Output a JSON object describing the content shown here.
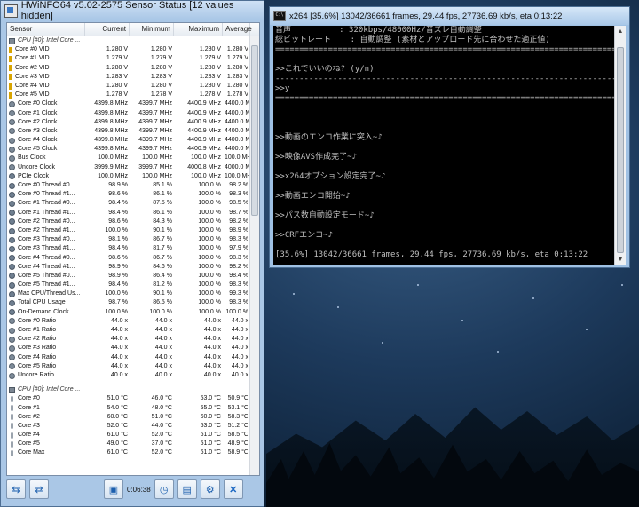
{
  "hwinfo": {
    "title": "HWiNFO64 v5.02-2575 Sensor Status [12 values hidden]",
    "columns": [
      "Sensor",
      "Current",
      "Minimum",
      "Maximum",
      "Average"
    ],
    "rows": [
      {
        "type": "group",
        "icon": "chip",
        "cells": [
          "CPU [#0]: Intel Core ...",
          "",
          "",
          "",
          ""
        ]
      },
      {
        "type": "volt",
        "cells": [
          "Core #0 VID",
          "1.280 V",
          "1.280 V",
          "1.280 V",
          "1.280 V"
        ]
      },
      {
        "type": "volt",
        "cells": [
          "Core #1 VID",
          "1.279 V",
          "1.279 V",
          "1.279 V",
          "1.279 V"
        ]
      },
      {
        "type": "volt",
        "cells": [
          "Core #2 VID",
          "1.280 V",
          "1.280 V",
          "1.280 V",
          "1.280 V"
        ]
      },
      {
        "type": "volt",
        "cells": [
          "Core #3 VID",
          "1.283 V",
          "1.283 V",
          "1.283 V",
          "1.283 V"
        ]
      },
      {
        "type": "volt",
        "cells": [
          "Core #4 VID",
          "1.280 V",
          "1.280 V",
          "1.280 V",
          "1.280 V"
        ]
      },
      {
        "type": "volt",
        "cells": [
          "Core #5 VID",
          "1.278 V",
          "1.278 V",
          "1.278 V",
          "1.278 V"
        ]
      },
      {
        "type": "clock",
        "cells": [
          "Core #0 Clock",
          "4399.8 MHz",
          "4399.7 MHz",
          "4400.9 MHz",
          "4400.0 MHz"
        ]
      },
      {
        "type": "clock",
        "cells": [
          "Core #1 Clock",
          "4399.8 MHz",
          "4399.7 MHz",
          "4400.9 MHz",
          "4400.0 MHz"
        ]
      },
      {
        "type": "clock",
        "cells": [
          "Core #2 Clock",
          "4399.8 MHz",
          "4399.7 MHz",
          "4400.9 MHz",
          "4400.0 MHz"
        ]
      },
      {
        "type": "clock",
        "cells": [
          "Core #3 Clock",
          "4399.8 MHz",
          "4399.7 MHz",
          "4400.9 MHz",
          "4400.0 MHz"
        ]
      },
      {
        "type": "clock",
        "cells": [
          "Core #4 Clock",
          "4399.8 MHz",
          "4399.7 MHz",
          "4400.9 MHz",
          "4400.0 MHz"
        ]
      },
      {
        "type": "clock",
        "cells": [
          "Core #5 Clock",
          "4399.8 MHz",
          "4399.7 MHz",
          "4400.9 MHz",
          "4400.0 MHz"
        ]
      },
      {
        "type": "clock",
        "cells": [
          "Bus Clock",
          "100.0 MHz",
          "100.0 MHz",
          "100.0 MHz",
          "100.0 MHz"
        ]
      },
      {
        "type": "clock",
        "cells": [
          "Uncore Clock",
          "3999.9 MHz",
          "3999.7 MHz",
          "4000.8 MHz",
          "4000.0 MHz"
        ]
      },
      {
        "type": "usage",
        "cells": [
          "PCIe Clock",
          "100.0 MHz",
          "100.0 MHz",
          "100.0 MHz",
          "100.0 MHz"
        ]
      },
      {
        "type": "usage",
        "cells": [
          "Core #0 Thread #0...",
          "98.9 %",
          "85.1 %",
          "100.0 %",
          "98.2 %"
        ]
      },
      {
        "type": "usage",
        "cells": [
          "Core #0 Thread #1...",
          "98.6 %",
          "86.1 %",
          "100.0 %",
          "98.3 %"
        ]
      },
      {
        "type": "usage",
        "cells": [
          "Core #1 Thread #0...",
          "98.4 %",
          "87.5 %",
          "100.0 %",
          "98.5 %"
        ]
      },
      {
        "type": "usage",
        "cells": [
          "Core #1 Thread #1...",
          "98.4 %",
          "86.1 %",
          "100.0 %",
          "98.7 %"
        ]
      },
      {
        "type": "usage",
        "cells": [
          "Core #2 Thread #0...",
          "98.6 %",
          "84.3 %",
          "100.0 %",
          "98.2 %"
        ]
      },
      {
        "type": "usage",
        "cells": [
          "Core #2 Thread #1...",
          "100.0 %",
          "90.1 %",
          "100.0 %",
          "98.9 %"
        ]
      },
      {
        "type": "usage",
        "cells": [
          "Core #3 Thread #0...",
          "98.1 %",
          "86.7 %",
          "100.0 %",
          "98.3 %"
        ]
      },
      {
        "type": "usage",
        "cells": [
          "Core #3 Thread #1...",
          "98.4 %",
          "81.7 %",
          "100.0 %",
          "97.9 %"
        ]
      },
      {
        "type": "usage",
        "cells": [
          "Core #4 Thread #0...",
          "98.6 %",
          "86.7 %",
          "100.0 %",
          "98.3 %"
        ]
      },
      {
        "type": "usage",
        "cells": [
          "Core #4 Thread #1...",
          "98.9 %",
          "84.6 %",
          "100.0 %",
          "98.2 %"
        ]
      },
      {
        "type": "usage",
        "cells": [
          "Core #5 Thread #0...",
          "98.9 %",
          "86.4 %",
          "100.0 %",
          "98.4 %"
        ]
      },
      {
        "type": "usage",
        "cells": [
          "Core #5 Thread #1...",
          "98.4 %",
          "81.2 %",
          "100.0 %",
          "98.3 %"
        ]
      },
      {
        "type": "usage",
        "cells": [
          "Max CPU/Thread Us...",
          "100.0 %",
          "90.1 %",
          "100.0 %",
          "99.3 %"
        ]
      },
      {
        "type": "usage",
        "cells": [
          "Total CPU Usage",
          "98.7 %",
          "86.5 %",
          "100.0 %",
          "98.3 %"
        ]
      },
      {
        "type": "usage",
        "cells": [
          "On-Demand Clock ...",
          "100.0 %",
          "100.0 %",
          "100.0 %",
          "100.0 %"
        ]
      },
      {
        "type": "clock",
        "cells": [
          "Core #0 Ratio",
          "44.0 x",
          "44.0 x",
          "44.0 x",
          "44.0 x"
        ]
      },
      {
        "type": "clock",
        "cells": [
          "Core #1 Ratio",
          "44.0 x",
          "44.0 x",
          "44.0 x",
          "44.0 x"
        ]
      },
      {
        "type": "clock",
        "cells": [
          "Core #2 Ratio",
          "44.0 x",
          "44.0 x",
          "44.0 x",
          "44.0 x"
        ]
      },
      {
        "type": "clock",
        "cells": [
          "Core #3 Ratio",
          "44.0 x",
          "44.0 x",
          "44.0 x",
          "44.0 x"
        ]
      },
      {
        "type": "clock",
        "cells": [
          "Core #4 Ratio",
          "44.0 x",
          "44.0 x",
          "44.0 x",
          "44.0 x"
        ]
      },
      {
        "type": "clock",
        "cells": [
          "Core #5 Ratio",
          "44.0 x",
          "44.0 x",
          "44.0 x",
          "44.0 x"
        ]
      },
      {
        "type": "clock",
        "cells": [
          "Uncore Ratio",
          "40.0 x",
          "40.0 x",
          "40.0 x",
          "40.0 x"
        ]
      },
      {
        "type": "blank",
        "cells": [
          "",
          "",
          "",
          "",
          ""
        ]
      },
      {
        "type": "group",
        "icon": "chip",
        "cells": [
          "CPU [#0]: Intel Core ...",
          "",
          "",
          "",
          ""
        ]
      },
      {
        "type": "temp",
        "cells": [
          "Core #0",
          "51.0 °C",
          "46.0 °C",
          "53.0 °C",
          "50.9 °C"
        ]
      },
      {
        "type": "temp",
        "cells": [
          "Core #1",
          "54.0 °C",
          "48.0 °C",
          "55.0 °C",
          "53.1 °C"
        ]
      },
      {
        "type": "temp",
        "cells": [
          "Core #2",
          "60.0 °C",
          "51.0 °C",
          "60.0 °C",
          "58.3 °C"
        ]
      },
      {
        "type": "temp",
        "cells": [
          "Core #3",
          "52.0 °C",
          "44.0 °C",
          "53.0 °C",
          "51.2 °C"
        ]
      },
      {
        "type": "temp",
        "cells": [
          "Core #4",
          "61.0 °C",
          "52.0 °C",
          "61.0 °C",
          "58.5 °C"
        ]
      },
      {
        "type": "temp",
        "cells": [
          "Core #5",
          "49.0 °C",
          "37.0 °C",
          "51.0 °C",
          "48.9 °C"
        ]
      },
      {
        "type": "temp",
        "cells": [
          "Core Max",
          "61.0 °C",
          "52.0 °C",
          "61.0 °C",
          "58.9 °C"
        ]
      }
    ],
    "timer": "0:06:38"
  },
  "console": {
    "title": "x264 [35.6%] 13042/36661 frames, 29.44 fps, 27736.69 kb/s, eta 0:13:22",
    "lines": [
      "音声          : 320kbps/48000Hz/音ズレ自動調整",
      "総ビットレート    : 自動調整 (素材とアップロード先に合わせた適正値)",
      "==============================================================================",
      "",
      ">>これでいいのね? (y/n)",
      "------------------------------------------------------------------------------",
      ">>y",
      "==============================================================================",
      "",
      "",
      "",
      ">>動画のエンコ作業に突入~♪",
      "",
      ">>映像AVS作成完了~♪",
      "",
      ">>x264オプション設定完了~♪",
      "",
      ">>動画エンコ開始~♪",
      "",
      ">>パス数自動設定モード~♪",
      "",
      ">>CRFエンコ~♪",
      "",
      "[35.6%] 13042/36661 frames, 29.44 fps, 27736.69 kb/s, eta 0:13:22"
    ]
  }
}
